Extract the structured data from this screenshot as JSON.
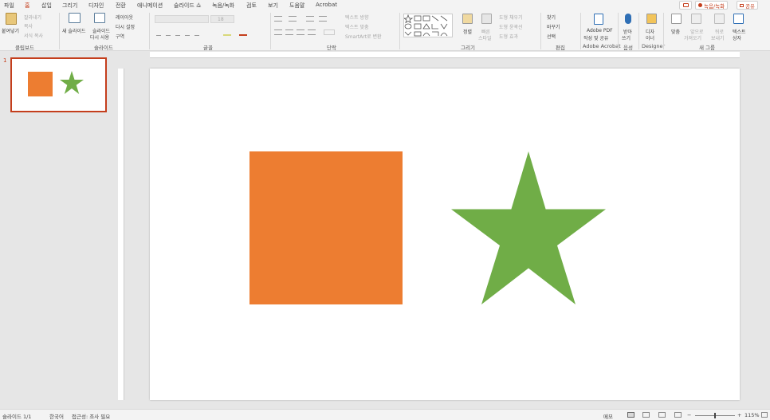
{
  "colors": {
    "accent": "#c43e1c",
    "rect_fill": "#ed7d31",
    "star_fill": "#70ad47"
  },
  "menu": {
    "tabs": [
      "파일",
      "홈",
      "삽입",
      "그리기",
      "디자인",
      "전환",
      "애니메이션",
      "슬라이드 쇼",
      "녹음/녹화",
      "검토",
      "보기",
      "도움말",
      "Acrobat"
    ],
    "active_tab": "홈",
    "record_label": "녹음/녹화",
    "share_label": "공유"
  },
  "ribbon": {
    "clipboard": {
      "paste": "붙여넣기",
      "cut": "잘라내기",
      "copy": "복사",
      "format_painter": "서식 복사",
      "label": "클립보드"
    },
    "slides": {
      "new_slide": "새 슬라이드",
      "reuse_1": "슬라이드",
      "reuse_2": "다시 사용",
      "layout": "레이아웃",
      "reset": "다시 설정",
      "section": "구역",
      "label": "슬라이드"
    },
    "font": {
      "label": "글꼴",
      "size_placeholder": "18"
    },
    "paragraph": {
      "text_direction": "텍스트 방향",
      "align_text": "텍스트 맞춤",
      "smartart": "SmartArt로 변환",
      "label": "단락"
    },
    "drawing": {
      "arrange": "정렬",
      "quick_styles_1": "빠른",
      "quick_styles_2": "스타일",
      "shape_fill": "도형 채우기",
      "shape_outline": "도형 윤곽선",
      "shape_effects": "도형 효과",
      "label": "그리기"
    },
    "editing": {
      "find": "찾기",
      "replace": "바꾸기",
      "select": "선택",
      "label": "편집"
    },
    "acrobat": {
      "line1": "Adobe PDF",
      "line2": "작성 및 공유",
      "label": "Adobe Acrobat"
    },
    "voice": {
      "line1": "받아",
      "line2": "쓰기",
      "label": "음성"
    },
    "designer": {
      "line1": "디자",
      "line2": "이너",
      "label": "Designer"
    },
    "newgroup": {
      "align": "맞춤",
      "bring_forward_1": "앞으로",
      "bring_forward_2": "가져오기",
      "send_back_1": "뒤로",
      "send_back_2": "보내기",
      "textbox_1": "텍스트",
      "textbox_2": "상자",
      "label": "새 그룹"
    }
  },
  "thumbnails": [
    {
      "number": "1"
    }
  ],
  "status": {
    "slide_count": "슬라이드 1/1",
    "language": "한국어",
    "accessibility": "접근성: 조사 필요",
    "notes": "메모",
    "zoom": "115%"
  }
}
